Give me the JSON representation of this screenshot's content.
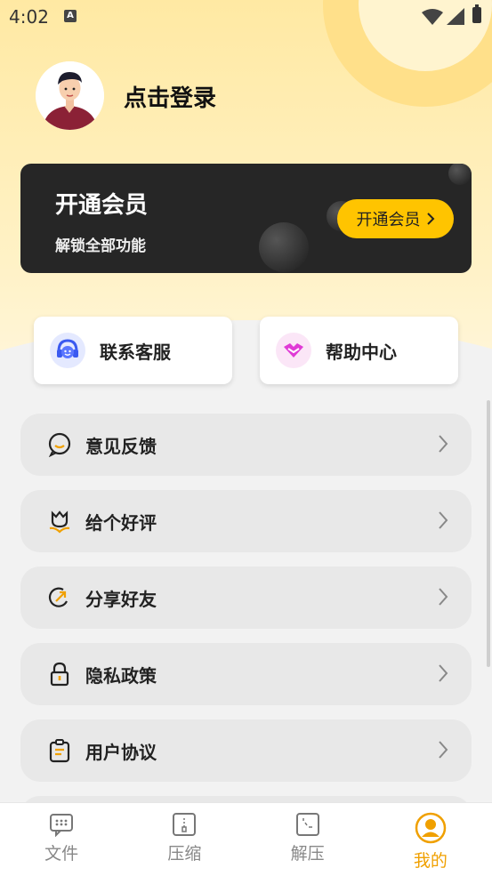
{
  "status_bar": {
    "time": "4:02",
    "sim_letter": "A"
  },
  "profile": {
    "login_text": "点击登录"
  },
  "vip_card": {
    "title": "开通会员",
    "subtitle": "解锁全部功能",
    "button_label": "开通会员"
  },
  "quick_actions": [
    {
      "label": "联系客服",
      "icon": "customer-service-icon"
    },
    {
      "label": "帮助中心",
      "icon": "help-center-icon"
    }
  ],
  "menu": [
    {
      "label": "意见反馈",
      "icon": "feedback-icon"
    },
    {
      "label": "给个好评",
      "icon": "flower-rating-icon"
    },
    {
      "label": "分享好友",
      "icon": "share-icon"
    },
    {
      "label": "隐私政策",
      "icon": "lock-icon"
    },
    {
      "label": "用户协议",
      "icon": "clipboard-icon"
    }
  ],
  "tabs": [
    {
      "label": "文件",
      "icon": "file-icon",
      "active": false
    },
    {
      "label": "压缩",
      "icon": "compress-icon",
      "active": false
    },
    {
      "label": "解压",
      "icon": "decompress-icon",
      "active": false
    },
    {
      "label": "我的",
      "icon": "profile-icon",
      "active": true
    }
  ],
  "colors": {
    "accent": "#f0a000",
    "vip_button": "#ffc400",
    "vip_card": "#262626"
  }
}
